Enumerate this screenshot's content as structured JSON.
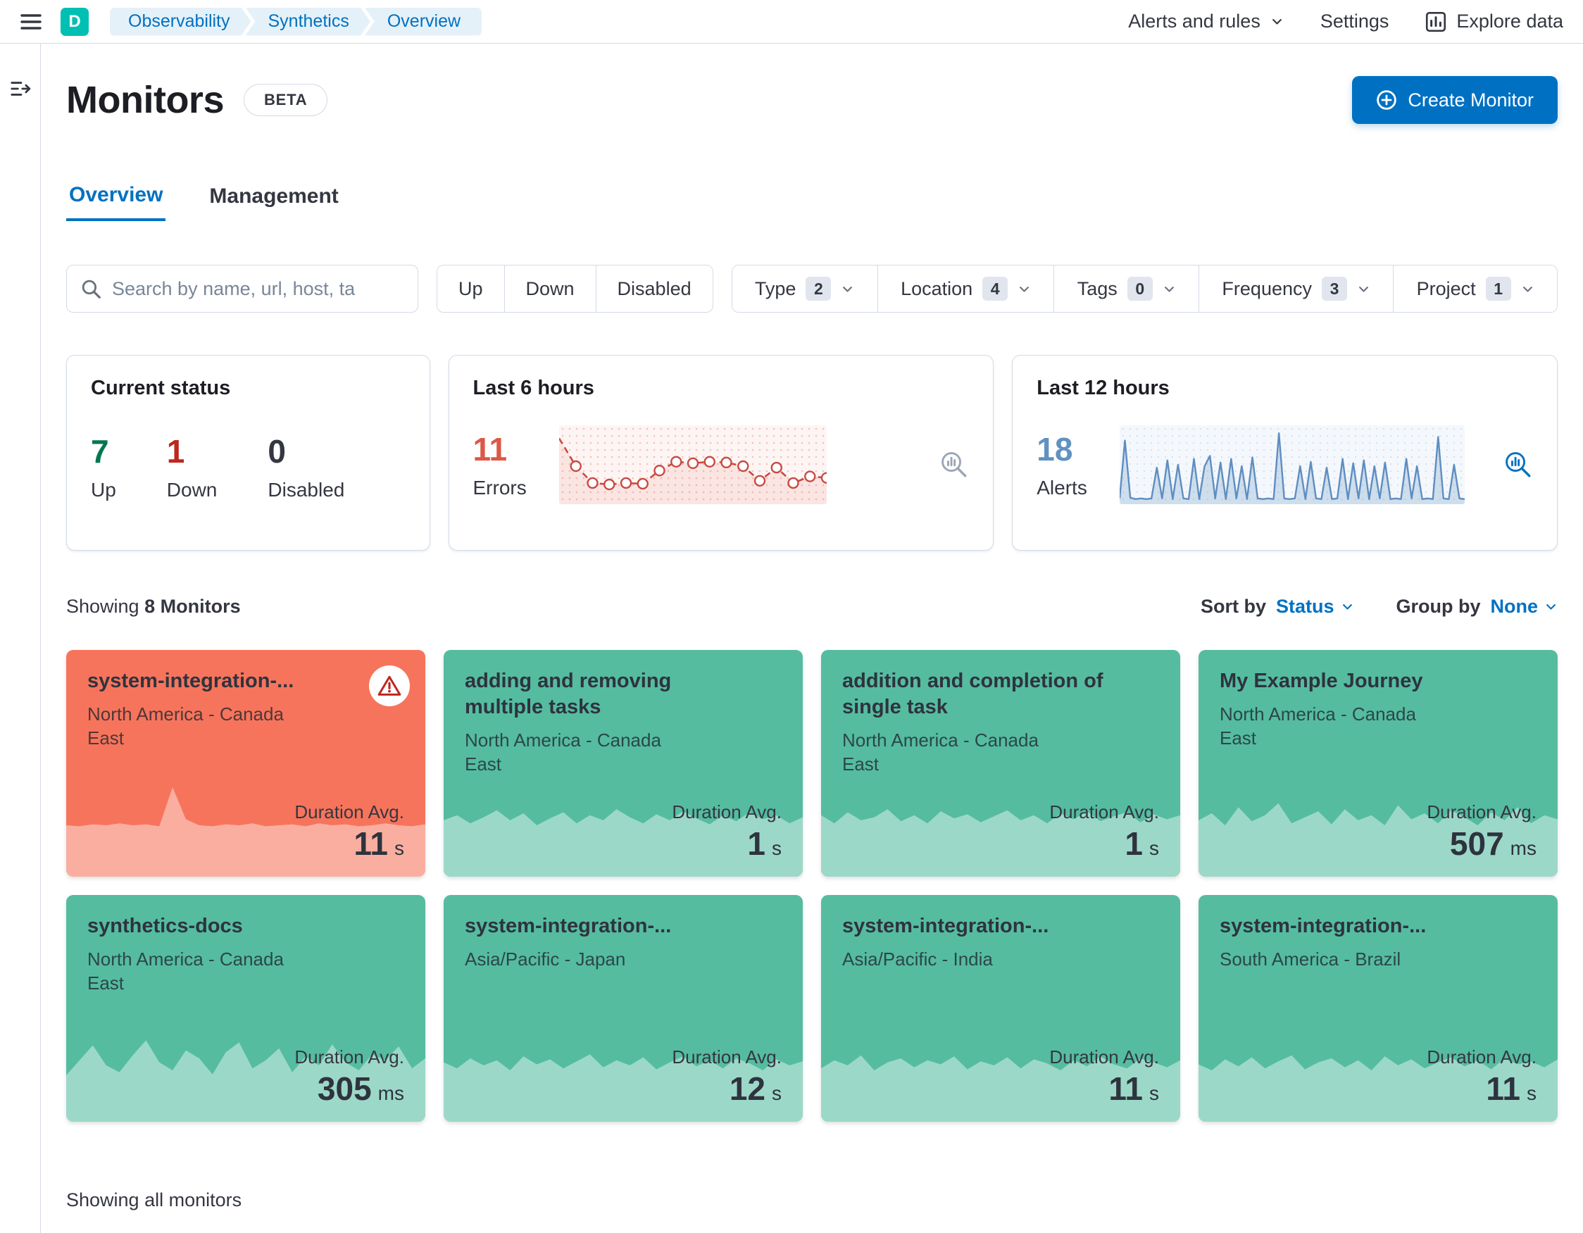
{
  "colors": {
    "primary": "#0071C2",
    "text": "#343741",
    "border": "#D3DAE6",
    "card_up": "#55BCA0",
    "card_down": "#F7745C",
    "errors": "#DD5846",
    "alerts": "#6092C0",
    "status_up": "#00784E",
    "status_down": "#BD271E"
  },
  "header": {
    "space_initial": "D",
    "breadcrumbs": [
      "Observability",
      "Synthetics",
      "Overview"
    ],
    "alerts_and_rules": "Alerts and rules",
    "settings": "Settings",
    "explore_data": "Explore data"
  },
  "page": {
    "title": "Monitors",
    "beta": "BETA",
    "create_monitor": "Create Monitor",
    "tabs": [
      "Overview",
      "Management"
    ]
  },
  "filters": {
    "search_placeholder": "Search by name, url, host, ta",
    "status_buttons": [
      "Up",
      "Down",
      "Disabled"
    ],
    "dropdowns": [
      {
        "label": "Type",
        "count": "2"
      },
      {
        "label": "Location",
        "count": "4"
      },
      {
        "label": "Tags",
        "count": "0"
      },
      {
        "label": "Frequency",
        "count": "3"
      },
      {
        "label": "Project",
        "count": "1"
      }
    ]
  },
  "stats": {
    "current_status": {
      "title": "Current status",
      "up": {
        "value": "7",
        "label": "Up"
      },
      "down": {
        "value": "1",
        "label": "Down"
      },
      "disabled": {
        "value": "0",
        "label": "Disabled"
      }
    },
    "last6": {
      "title": "Last 6 hours",
      "value": "11",
      "label": "Errors",
      "chart": {
        "type": "line",
        "points": [
          0.88,
          0.5,
          0.27,
          0.25,
          0.27,
          0.26,
          0.44,
          0.56,
          0.54,
          0.56,
          0.55,
          0.5,
          0.3,
          0.48,
          0.27,
          0.36,
          0.34
        ]
      }
    },
    "last12": {
      "title": "Last 12 hours",
      "value": "18",
      "label": "Alerts",
      "chart": {
        "type": "area",
        "points": [
          0.06,
          0.85,
          0.07,
          0.05,
          0.06,
          0.05,
          0.06,
          0.48,
          0.06,
          0.58,
          0.05,
          0.52,
          0.06,
          0.05,
          0.6,
          0.05,
          0.5,
          0.64,
          0.06,
          0.55,
          0.05,
          0.6,
          0.06,
          0.5,
          0.05,
          0.62,
          0.06,
          0.05,
          0.06,
          0.05,
          0.95,
          0.06,
          0.05,
          0.06,
          0.5,
          0.05,
          0.56,
          0.06,
          0.05,
          0.48,
          0.05,
          0.06,
          0.6,
          0.05,
          0.54,
          0.06,
          0.58,
          0.05,
          0.5,
          0.06,
          0.55,
          0.05,
          0.06,
          0.05,
          0.6,
          0.06,
          0.5,
          0.05,
          0.06,
          0.05,
          0.9,
          0.06,
          0.05,
          0.52,
          0.06,
          0.05
        ]
      }
    }
  },
  "list": {
    "showing_prefix": "Showing",
    "showing_count": "8 Monitors",
    "sort_by_label": "Sort by",
    "sort_by_value": "Status",
    "group_by_label": "Group by",
    "group_by_value": "None",
    "footer": "Showing all monitors"
  },
  "monitors": [
    {
      "name": "system-integration-...",
      "location": "North America - Canada East",
      "status": "down",
      "duration_label": "Duration Avg.",
      "duration_value": "11",
      "duration_unit": "s",
      "spark": [
        0.5,
        0.49,
        0.51,
        0.5,
        0.52,
        0.5,
        0.51,
        0.49,
        0.88,
        0.56,
        0.5,
        0.49,
        0.51,
        0.5,
        0.52,
        0.49,
        0.5,
        0.51,
        0.49,
        0.52,
        0.5,
        0.51,
        0.49,
        0.5,
        0.52,
        0.5,
        0.49,
        0.51
      ]
    },
    {
      "name": "adding and removing multiple tasks",
      "location": "North America - Canada East",
      "status": "up",
      "duration_label": "Duration Avg.",
      "duration_value": "1",
      "duration_unit": "s",
      "spark": [
        0.55,
        0.6,
        0.52,
        0.58,
        0.65,
        0.55,
        0.62,
        0.5,
        0.57,
        0.63,
        0.52,
        0.6,
        0.55,
        0.66,
        0.58,
        0.52,
        0.61,
        0.55,
        0.64,
        0.57,
        0.51,
        0.6,
        0.54,
        0.63,
        0.56,
        0.6,
        0.52,
        0.58
      ]
    },
    {
      "name": "addition and completion of single task",
      "location": "North America - Canada East",
      "status": "up",
      "duration_label": "Duration Avg.",
      "duration_value": "1",
      "duration_unit": "s",
      "spark": [
        0.6,
        0.52,
        0.63,
        0.55,
        0.58,
        0.66,
        0.54,
        0.6,
        0.52,
        0.64,
        0.57,
        0.61,
        0.53,
        0.59,
        0.65,
        0.55,
        0.6,
        0.52,
        0.62,
        0.56,
        0.64,
        0.54,
        0.59,
        0.63,
        0.53,
        0.61,
        0.56,
        0.6
      ]
    },
    {
      "name": "My Example Journey",
      "location": "North America - Canada East",
      "status": "up",
      "duration_label": "Duration Avg.",
      "duration_value": "507",
      "duration_unit": "ms",
      "spark": [
        0.55,
        0.62,
        0.5,
        0.68,
        0.54,
        0.6,
        0.72,
        0.52,
        0.58,
        0.64,
        0.51,
        0.66,
        0.55,
        0.6,
        0.5,
        0.7,
        0.56,
        0.62,
        0.52,
        0.65,
        0.58,
        0.5,
        0.63,
        0.55,
        0.68,
        0.52,
        0.6,
        0.56
      ]
    },
    {
      "name": "synthetics-docs",
      "location": "North America - Canada East",
      "status": "up",
      "duration_label": "Duration Avg.",
      "duration_value": "305",
      "duration_unit": "ms",
      "spark": [
        0.45,
        0.6,
        0.75,
        0.55,
        0.48,
        0.65,
        0.8,
        0.58,
        0.5,
        0.7,
        0.62,
        0.46,
        0.68,
        0.78,
        0.52,
        0.6,
        0.72,
        0.48,
        0.64,
        0.55,
        0.76,
        0.58,
        0.5,
        0.66,
        0.6,
        0.74,
        0.52,
        0.62
      ]
    },
    {
      "name": "system-integration-...",
      "location": "Asia/Pacific - Japan",
      "status": "up",
      "duration_label": "Duration Avg.",
      "duration_value": "12",
      "duration_unit": "s",
      "spark": [
        0.58,
        0.52,
        0.62,
        0.55,
        0.6,
        0.5,
        0.64,
        0.56,
        0.61,
        0.52,
        0.59,
        0.66,
        0.53,
        0.6,
        0.55,
        0.63,
        0.51,
        0.58,
        0.64,
        0.54,
        0.6,
        0.52,
        0.62,
        0.57,
        0.5,
        0.61,
        0.55,
        0.59
      ]
    },
    {
      "name": "system-integration-...",
      "location": "Asia/Pacific - India",
      "status": "up",
      "duration_label": "Duration Avg.",
      "duration_value": "11",
      "duration_unit": "s",
      "spark": [
        0.52,
        0.6,
        0.55,
        0.65,
        0.5,
        0.58,
        0.62,
        0.53,
        0.6,
        0.56,
        0.64,
        0.51,
        0.59,
        0.55,
        0.63,
        0.52,
        0.61,
        0.57,
        0.5,
        0.6,
        0.54,
        0.64,
        0.56,
        0.52,
        0.62,
        0.58,
        0.53,
        0.6
      ]
    },
    {
      "name": "system-integration-...",
      "location": "South America - Brazil",
      "status": "up",
      "duration_label": "Duration Avg.",
      "duration_value": "11",
      "duration_unit": "s",
      "spark": [
        0.56,
        0.5,
        0.61,
        0.54,
        0.63,
        0.52,
        0.59,
        0.65,
        0.51,
        0.58,
        0.62,
        0.53,
        0.6,
        0.5,
        0.64,
        0.55,
        0.61,
        0.52,
        0.58,
        0.63,
        0.54,
        0.6,
        0.51,
        0.62,
        0.56,
        0.59,
        0.53,
        0.61
      ]
    }
  ]
}
